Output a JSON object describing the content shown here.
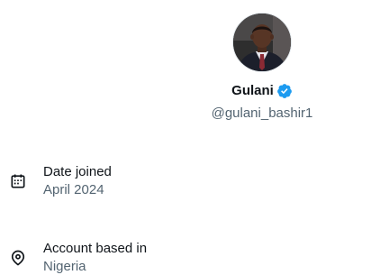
{
  "profile": {
    "display_name": "Gulani",
    "handle": "@gulani_bashir1",
    "verified": true,
    "verified_icon": "verified-badge-icon",
    "verified_color": "#1d9bf0"
  },
  "details": {
    "joined": {
      "icon": "calendar-icon",
      "label": "Date joined",
      "value": "April 2024"
    },
    "based": {
      "icon": "location-pin-icon",
      "label": "Account based in",
      "value": "Nigeria"
    }
  },
  "colors": {
    "primary_text": "#0f1419",
    "secondary_text": "#536471"
  }
}
